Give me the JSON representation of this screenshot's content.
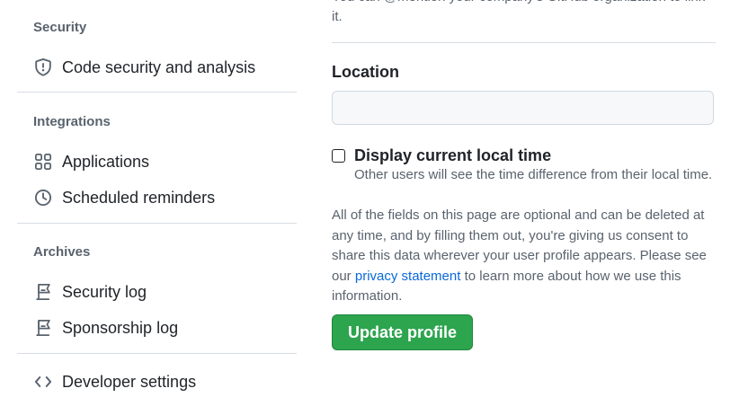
{
  "sidebar": {
    "sections": [
      {
        "title": "Security"
      },
      {
        "title": "Integrations"
      },
      {
        "title": "Archives"
      }
    ],
    "items": {
      "code_security": "Code security and analysis",
      "applications": "Applications",
      "scheduled_reminders": "Scheduled reminders",
      "security_log": "Security log",
      "sponsorship_log": "Sponsorship log",
      "developer_settings": "Developer settings"
    }
  },
  "main": {
    "top_text": "You can @mention your company's GitHub organization to link it.",
    "location": {
      "label": "Location",
      "value": "",
      "placeholder": ""
    },
    "local_time": {
      "label": "Display current local time",
      "note": "Other users will see the time difference from their local time.",
      "checked": false
    },
    "info": {
      "before_link": "All of the fields on this page are optional and can be deleted at any time, and by filling them out, you're giving us consent to share this data wherever your user profile appears. Please see our ",
      "link": "privacy statement",
      "after_link": " to learn more about how we use this information."
    },
    "update_button": "Update profile"
  },
  "colors": {
    "accent_link": "#0969da",
    "button_green": "#2da44e",
    "muted_text": "#59636e",
    "divider": "#d8dee4"
  },
  "icons": [
    "shield-icon",
    "apps-grid-icon",
    "clock-icon",
    "log-icon",
    "log-icon",
    "code-icon"
  ]
}
